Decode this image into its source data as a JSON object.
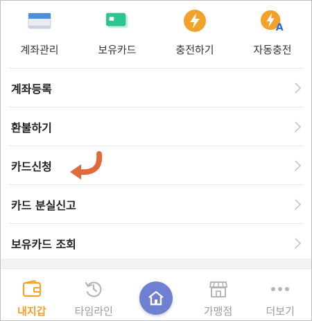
{
  "quick_actions": [
    {
      "label": "계좌관리",
      "icon": "bank-card-icon"
    },
    {
      "label": "보유카드",
      "icon": "card-icon"
    },
    {
      "label": "충전하기",
      "icon": "lightning-icon"
    },
    {
      "label": "자동충전",
      "icon": "auto-charge-icon"
    }
  ],
  "menu": [
    {
      "label": "계좌등록"
    },
    {
      "label": "환불하기"
    },
    {
      "label": "카드신청"
    },
    {
      "label": "카드 분실신고"
    },
    {
      "label": "보유카드 조회"
    }
  ],
  "bottom_nav": [
    {
      "label": "내지갑",
      "icon": "wallet-icon",
      "active": true
    },
    {
      "label": "타임라인",
      "icon": "history-icon",
      "active": false
    },
    {
      "label": "",
      "icon": "home-icon",
      "active": false
    },
    {
      "label": "가맹점",
      "icon": "store-icon",
      "active": false
    },
    {
      "label": "더보기",
      "icon": "more-dots-icon",
      "active": false
    }
  ],
  "colors": {
    "accent_orange": "#f2a12a",
    "annotation_arrow": "#e06a3a",
    "home_button": "#6f7fd1",
    "card_green": "#2ec48f",
    "card_blue": "#4a90d9"
  }
}
